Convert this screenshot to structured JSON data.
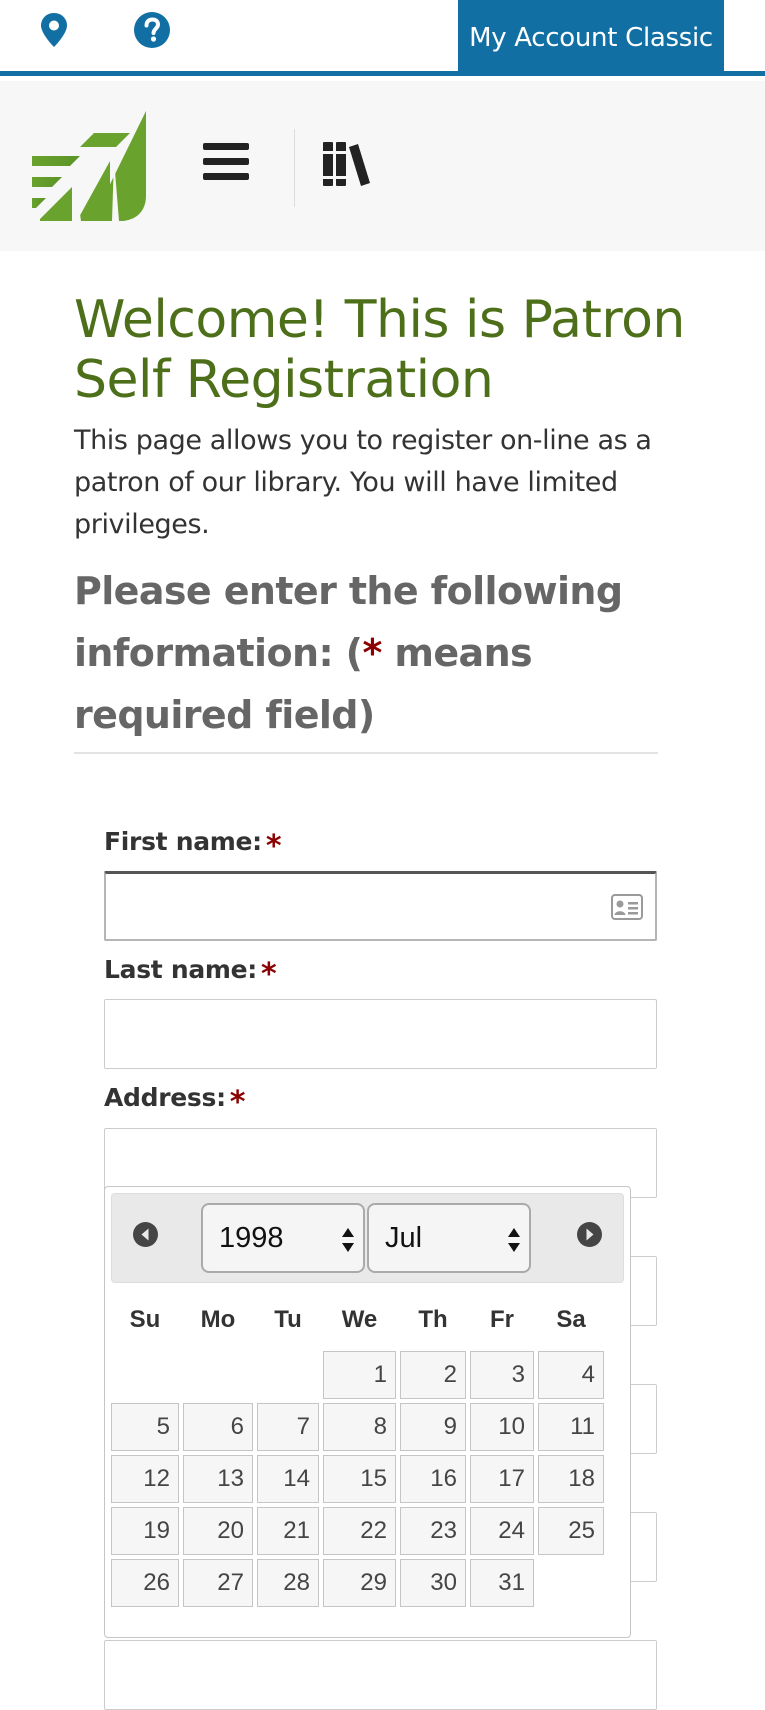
{
  "topbar": {
    "location_icon": "map-marker-icon",
    "help_icon": "question-circle-icon",
    "account_button": "My Account Classic",
    "accent_color": "#126fa3"
  },
  "header": {
    "logo_icon": "library-leaf-logo",
    "menu_icon": "hamburger-menu-icon",
    "books_icon": "books-icon"
  },
  "main": {
    "title": "Welcome! This is Patron Self Registration",
    "intro": "This page allows you to register on-line as a patron of our library. You will have limited privileges.",
    "section_heading_before": "Please enter the following information: (",
    "required_marker": "*",
    "section_heading_after": " means required field)"
  },
  "form": {
    "first_name_label": "First name:",
    "first_name_value": "",
    "last_name_label": "Last name:",
    "last_name_value": "",
    "address_label": "Address:",
    "address_value": "",
    "required_marker": "*"
  },
  "datepicker": {
    "selected_year": "1998",
    "selected_month": "Jul",
    "weekdays": [
      "Su",
      "Mo",
      "Tu",
      "We",
      "Th",
      "Fr",
      "Sa"
    ],
    "weeks": [
      [
        "",
        "",
        "",
        "1",
        "2",
        "3",
        "4"
      ],
      [
        "5",
        "6",
        "7",
        "8",
        "9",
        "10",
        "11"
      ],
      [
        "12",
        "13",
        "14",
        "15",
        "16",
        "17",
        "18"
      ],
      [
        "19",
        "20",
        "21",
        "22",
        "23",
        "24",
        "25"
      ],
      [
        "26",
        "27",
        "28",
        "29",
        "30",
        "31",
        ""
      ]
    ]
  },
  "colors": {
    "title_green": "#4d6f1a",
    "required_red": "#8b0000",
    "heading_gray": "#666666"
  }
}
